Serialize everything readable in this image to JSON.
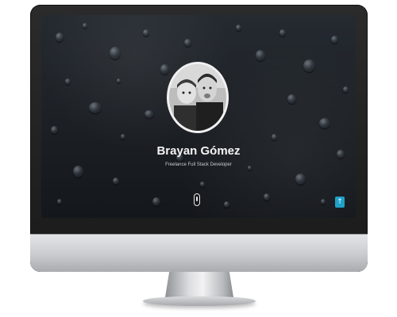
{
  "profile": {
    "name": "Brayan Gómez",
    "title": "Freelance Full Stack Developer",
    "avatar_alt": "profile photo"
  },
  "controls": {
    "scroll_icon": "mouse-scroll-icon",
    "back_to_top_icon": "arrow-up-icon",
    "back_to_top_glyph": "↑"
  },
  "colors": {
    "screen_background": "#1b1f24",
    "accent_button": "#1ea1c9",
    "monitor_frame": "#1a1a1a",
    "monitor_chin": "#c9cbce"
  }
}
